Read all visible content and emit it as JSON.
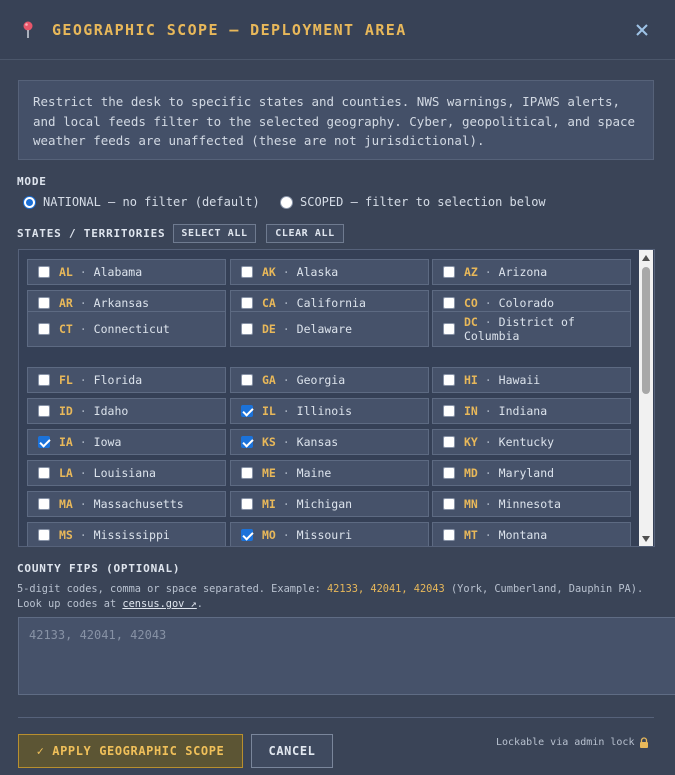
{
  "header": {
    "title": "GEOGRAPHIC SCOPE — DEPLOYMENT AREA",
    "icon": "map-pin-icon",
    "close_icon": "close-icon"
  },
  "info": {
    "text": "Restrict the desk to specific states and counties. NWS warnings, IPAWS alerts, and local feeds filter to the selected geography. Cyber, geopolitical, and space weather feeds are unaffected (these are not jurisdictional)."
  },
  "mode": {
    "label": "MODE",
    "options": [
      {
        "label": "NATIONAL — no filter (default)",
        "checked": true
      },
      {
        "label": "SCOPED — filter to selection below",
        "checked": false
      }
    ]
  },
  "states_section": {
    "label": "STATES / TERRITORIES",
    "select_all": "SELECT ALL",
    "clear_all": "CLEAR ALL",
    "separator": "·",
    "items": [
      {
        "code": "AL",
        "name": "Alabama",
        "checked": false
      },
      {
        "code": "AK",
        "name": "Alaska",
        "checked": false
      },
      {
        "code": "AZ",
        "name": "Arizona",
        "checked": false
      },
      {
        "code": "AR",
        "name": "Arkansas",
        "checked": false
      },
      {
        "code": "CA",
        "name": "California",
        "checked": false
      },
      {
        "code": "CO",
        "name": "Colorado",
        "checked": false
      },
      {
        "code": "CT",
        "name": "Connecticut",
        "checked": false
      },
      {
        "code": "DE",
        "name": "Delaware",
        "checked": false
      },
      {
        "code": "DC",
        "name": "District of Columbia",
        "checked": false
      },
      {
        "code": "FL",
        "name": "Florida",
        "checked": false
      },
      {
        "code": "GA",
        "name": "Georgia",
        "checked": false
      },
      {
        "code": "HI",
        "name": "Hawaii",
        "checked": false
      },
      {
        "code": "ID",
        "name": "Idaho",
        "checked": false
      },
      {
        "code": "IL",
        "name": "Illinois",
        "checked": true
      },
      {
        "code": "IN",
        "name": "Indiana",
        "checked": false
      },
      {
        "code": "IA",
        "name": "Iowa",
        "checked": true
      },
      {
        "code": "KS",
        "name": "Kansas",
        "checked": true
      },
      {
        "code": "KY",
        "name": "Kentucky",
        "checked": false
      },
      {
        "code": "LA",
        "name": "Louisiana",
        "checked": false
      },
      {
        "code": "ME",
        "name": "Maine",
        "checked": false
      },
      {
        "code": "MD",
        "name": "Maryland",
        "checked": false
      },
      {
        "code": "MA",
        "name": "Massachusetts",
        "checked": false
      },
      {
        "code": "MI",
        "name": "Michigan",
        "checked": false
      },
      {
        "code": "MN",
        "name": "Minnesota",
        "checked": false
      },
      {
        "code": "MS",
        "name": "Mississippi",
        "checked": false
      },
      {
        "code": "MO",
        "name": "Missouri",
        "checked": true
      },
      {
        "code": "MT",
        "name": "Montana",
        "checked": false
      }
    ]
  },
  "fips": {
    "label": "COUNTY FIPS (OPTIONAL)",
    "help_prefix": "5-digit codes, comma or space separated. Example: ",
    "help_codes": "42133, 42041, 42043",
    "help_suffix": " (York, Cumberland, Dauphin PA). Look up codes at ",
    "help_link": "census.gov ↗",
    "help_end": ".",
    "placeholder": "42133, 42041, 42043",
    "value": ""
  },
  "footer": {
    "apply_label": "✓ APPLY GEOGRAPHIC SCOPE",
    "cancel_label": "CANCEL",
    "lock_note": "Lockable via admin lock",
    "lock_icon": "lock-icon"
  },
  "colors": {
    "accent": "#e8b85a",
    "background": "#3a4457",
    "checkbox_checked": "#1b72da"
  }
}
